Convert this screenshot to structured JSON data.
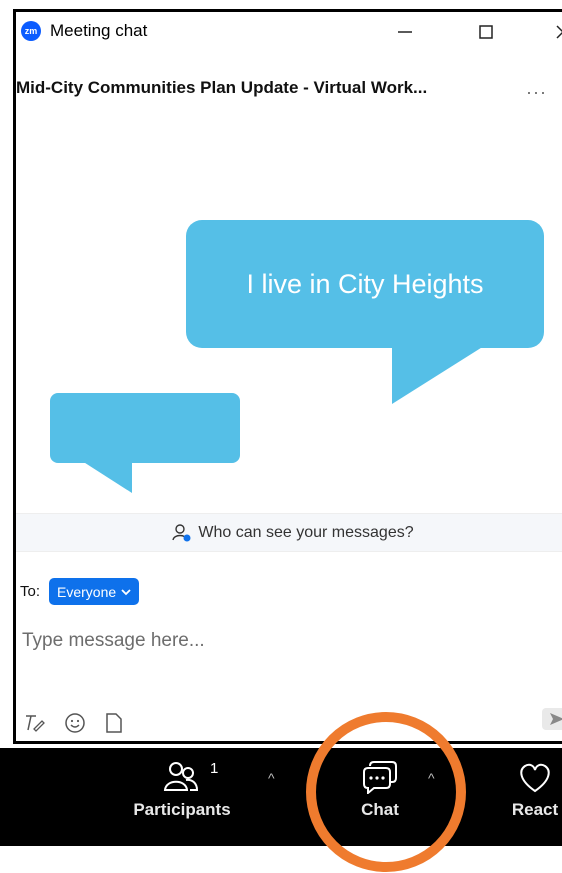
{
  "window": {
    "title": "Meeting chat",
    "app_logo": "zm",
    "controls": {
      "minimize": "minimize-icon",
      "maximize": "maximize-icon",
      "close": "close-icon"
    }
  },
  "meeting": {
    "title": "Mid-City Communities Plan Update - Virtual Work...",
    "more_icon": "more-dots-icon"
  },
  "bubbles": {
    "primary_text": "I live in City Heights",
    "secondary_text": "",
    "color": "#55bfe7"
  },
  "privacy": {
    "text": "Who can see your messages?",
    "icon": "participant-privacy-icon"
  },
  "composer": {
    "to_label": "To:",
    "recipient": "Everyone",
    "placeholder": "Type message here...",
    "tools": [
      "format-text-icon",
      "emoji-icon",
      "file-icon"
    ],
    "send_icon": "send-icon"
  },
  "toolbar": {
    "participants_label": "Participants",
    "participants_count": "1",
    "chat_label": "Chat",
    "react_label": "React"
  },
  "accent": {
    "highlight": "#ef7b2e",
    "zoom_blue": "#0e71eb"
  }
}
